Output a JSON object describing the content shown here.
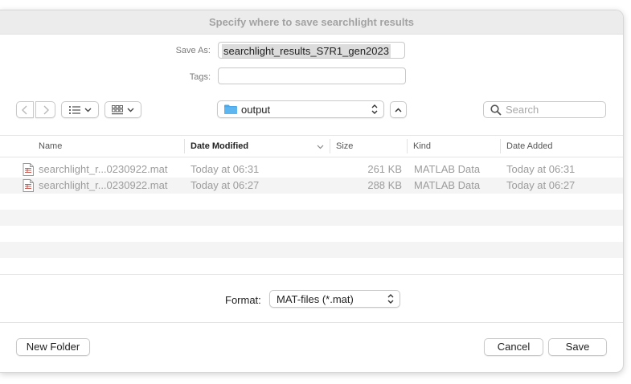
{
  "dialog": {
    "title": "Specify where to save searchlight results",
    "save_as_label": "Save As:",
    "save_as_value": "searchlight_results_S7R1_gen2023",
    "tags_label": "Tags:",
    "tags_value": ""
  },
  "toolbar": {
    "back_icon": "chevron-left-icon",
    "forward_icon": "chevron-right-icon",
    "list_view_icon": "list-view-icon",
    "grid_view_icon": "grid-view-icon",
    "location": "output",
    "search_placeholder": "Search"
  },
  "columns": [
    "Name",
    "Date Modified",
    "Size",
    "Kind",
    "Date Added"
  ],
  "files": [
    {
      "name": "searchlight_r...0230922.mat",
      "modified": "Today at 06:31",
      "size": "261 KB",
      "kind": "MATLAB Data",
      "added": "Today at 06:31"
    },
    {
      "name": "searchlight_r...0230922.mat",
      "modified": "Today at 06:27",
      "size": "288 KB",
      "kind": "MATLAB Data",
      "added": "Today at 06:27"
    }
  ],
  "format": {
    "label": "Format:",
    "value": "MAT-files (*.mat)"
  },
  "buttons": {
    "new_folder": "New Folder",
    "cancel": "Cancel",
    "save": "Save"
  },
  "colors": {
    "folder": "#4aa8ea",
    "title_text": "#a3a3a3",
    "stripe": "#f4f4f4"
  }
}
